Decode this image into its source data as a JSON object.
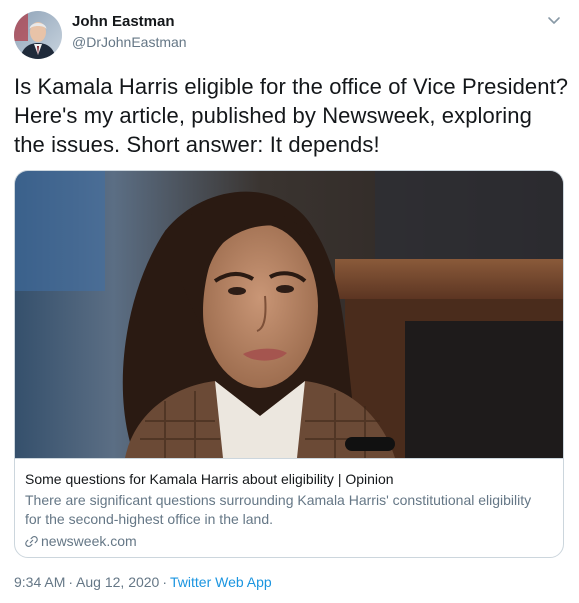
{
  "author": {
    "name": "John Eastman",
    "handle": "@DrJohnEastman"
  },
  "tweet": {
    "text": "Is Kamala Harris eligible for the office of Vice President?\nHere's my article, published by Newsweek, exploring\nthe issues.  Short answer: It depends!"
  },
  "card": {
    "title": "Some questions for Kamala Harris about eligibility | Opinion",
    "description_line1": "There are significant questions surrounding Kamala Harris' constitutional eligibility",
    "description_line2": "for the second-highest office in the land.",
    "domain": "newsweek.com"
  },
  "meta": {
    "time": "9:34 AM",
    "separator": "·",
    "date": "Aug 12, 2020",
    "app": "Twitter Web App"
  },
  "icons": {
    "caret": "chevron-down-icon",
    "link": "link-icon"
  },
  "colors": {
    "link": "#1b95e0",
    "secondary_text": "#657786",
    "border": "#ccd6dd"
  }
}
